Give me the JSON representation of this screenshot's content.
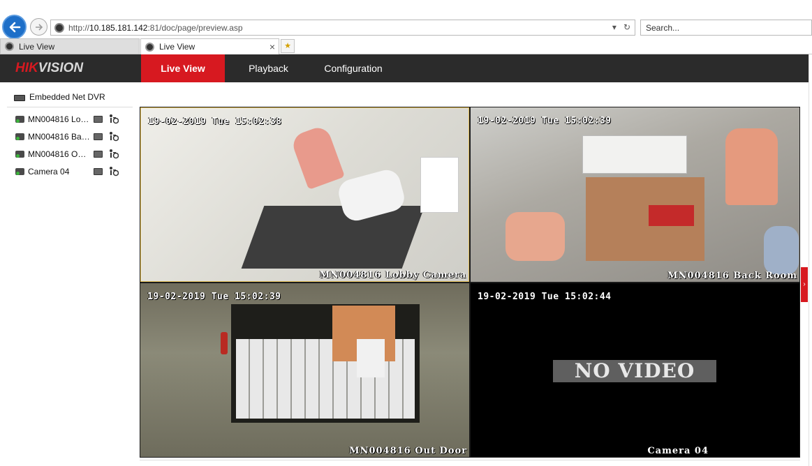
{
  "browser": {
    "url_prefix": "http://",
    "url_host": "10.185.181.142",
    "url_rest": ":81/doc/page/preview.asp",
    "search_placeholder": "Search...",
    "tabs": [
      {
        "label": "Live View"
      },
      {
        "label": "Live View"
      }
    ],
    "tab_close": "×",
    "icon_dropdown": "▾",
    "icon_refresh": "↻"
  },
  "app": {
    "logo_a": "HIK",
    "logo_b": "VISION",
    "menu": [
      {
        "label": "Live View"
      },
      {
        "label": "Playback"
      },
      {
        "label": "Configuration"
      }
    ],
    "accent": "#d71920"
  },
  "sidebar": {
    "device": "Embedded Net DVR",
    "cameras": [
      {
        "label": "MN004816 Lobby Camera"
      },
      {
        "label": "MN004816 Back Room"
      },
      {
        "label": "MN004816 Out Door"
      },
      {
        "label": "Camera 04"
      }
    ]
  },
  "video": {
    "panes": [
      {
        "time": "19-02-2019 Tue 15:02:38",
        "name": "MN004816 Lobby Camera"
      },
      {
        "time": "19-02-2019 Tue 15:02:39",
        "name": "MN004816 Back Room"
      },
      {
        "time": "19-02-2019 Tue 15:02:39",
        "name": "MN004816 Out Door"
      },
      {
        "time": "19-02-2019 Tue 15:02:44",
        "name": "Camera 04"
      }
    ],
    "no_video": "NO VIDEO"
  }
}
